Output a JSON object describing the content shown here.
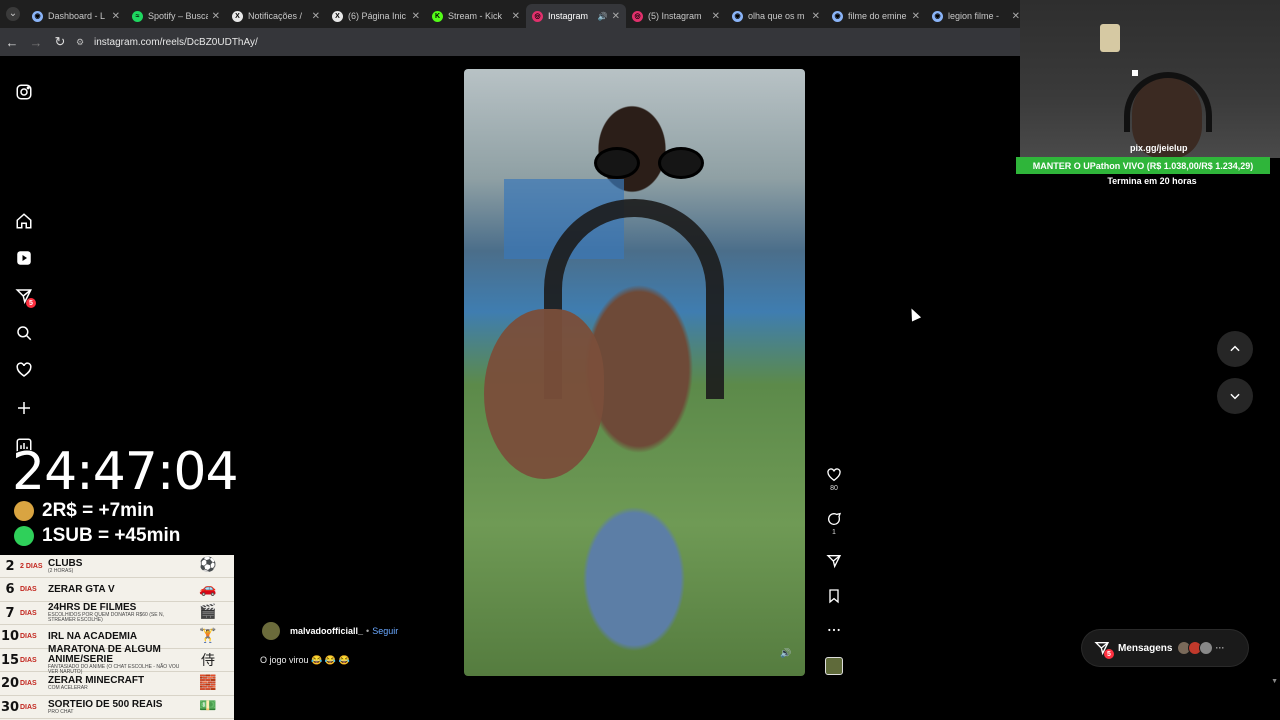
{
  "browser": {
    "tabs": [
      {
        "label": "Dashboard - L",
        "favicon_color": "#8ab4f8",
        "favicon_glyph": "globe-icon",
        "active": false
      },
      {
        "label": "Spotify – Busca",
        "favicon_color": "#1ed760",
        "favicon_glyph": "spotify-icon",
        "active": false
      },
      {
        "label": "Notificações /",
        "favicon_color": "#e8e8e8",
        "favicon_glyph": "x-icon",
        "active": false
      },
      {
        "label": "(6) Página Inic",
        "favicon_color": "#e8e8e8",
        "favicon_glyph": "x-icon",
        "active": false
      },
      {
        "label": "Stream - Kick",
        "favicon_color": "#53fc18",
        "favicon_glyph": "kick-icon",
        "active": false
      },
      {
        "label": "Instagram",
        "favicon_color": "#e1306c",
        "favicon_glyph": "instagram-icon",
        "active": true
      },
      {
        "label": "(5) Instagram",
        "favicon_color": "#e1306c",
        "favicon_glyph": "instagram-icon",
        "active": false
      },
      {
        "label": "olha que os m",
        "favicon_color": "#8ab4f8",
        "favicon_glyph": "globe-icon",
        "active": false
      },
      {
        "label": "filme do emine",
        "favicon_color": "#8ab4f8",
        "favicon_glyph": "globe-icon",
        "active": false
      },
      {
        "label": "legion filme -",
        "favicon_color": "#8ab4f8",
        "favicon_glyph": "globe-icon",
        "active": false
      }
    ],
    "url": "instagram.com/reels/DcBZ0UDThAy/"
  },
  "reel": {
    "username": "malvadoofficiall_",
    "separator": "•",
    "follow_label": "Seguir",
    "caption": "O jogo virou 😂 😂 😂",
    "likes": "80",
    "comments": "1"
  },
  "messages": {
    "label": "Mensagens",
    "badge": "5",
    "avatar_colors": [
      "#7a6a5a",
      "#c0392b",
      "#888888"
    ],
    "more": "···"
  },
  "sidebar": {
    "notifications_badge": "5"
  },
  "stream": {
    "timer": "24:47:04",
    "rates": [
      {
        "text": "2R$ = +7min",
        "icon": "money-bag-icon",
        "color": "#d9a441"
      },
      {
        "text": "1SUB = +45min",
        "icon": "green-dot-icon",
        "color": "#2fd05a"
      }
    ],
    "goals": [
      {
        "n": "2",
        "d": "2 DIAS",
        "t": "CLUBS",
        "sub": "(2 HORAS)"
      },
      {
        "n": "6",
        "d": "DIAS",
        "t": "ZERAR GTA V",
        "sub": ""
      },
      {
        "n": "7",
        "d": "DIAS",
        "t": "24HRS DE FILMES",
        "sub": "ESCOLHIDOS POR QUEM DONATAR R$60 (SE N, STREAMER ESCOLHE)"
      },
      {
        "n": "10",
        "d": "DIAS",
        "t": "IRL NA ACADEMIA",
        "sub": ""
      },
      {
        "n": "15",
        "d": "DIAS",
        "t": "MARATONA DE ALGUM ANIME/SERIE",
        "sub": "FANTASIADO DO ANIME (O CHAT ESCOLHE - NÃO VOU VER NARUTO)"
      },
      {
        "n": "20",
        "d": "DIAS",
        "t": "ZERAR MINECRAFT",
        "sub": "COM ACELERAR"
      },
      {
        "n": "30",
        "d": "DIAS",
        "t": "SORTEIO DE 500 REAIS",
        "sub": "PRO CHAT"
      }
    ],
    "goal_pics": [
      "⚽",
      "🚗",
      "🎬",
      "🏋",
      "侍",
      "🧱",
      "💵"
    ],
    "cam_link": "pix.gg/jeielup",
    "upathon": "MANTER O UPathon VIVO (R$ 1.038,00/R$ 1.234,29)",
    "upathon_sub": "Termina em 20 horas"
  }
}
